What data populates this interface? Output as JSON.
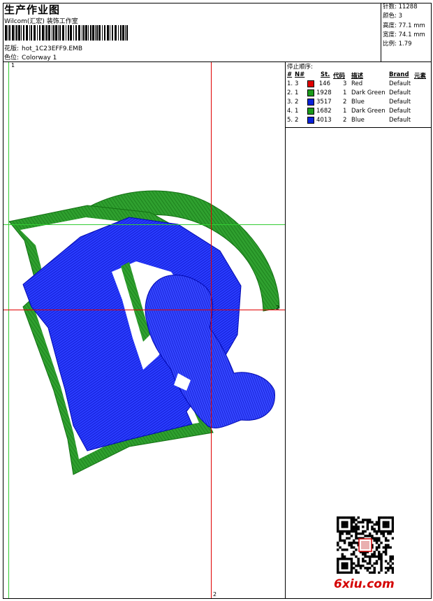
{
  "header": {
    "title": "生产作业图",
    "company": "Wilcom(汇宏) 装饰工作室",
    "design_label": "花版:",
    "design_file": "hot_1C23EFF9.EMB",
    "colorway_label": "色位:",
    "colorway": "Colorway 1"
  },
  "specs": [
    {
      "label": "针数:",
      "value": "11288"
    },
    {
      "label": "颜色:",
      "value": "3"
    },
    {
      "label": "高度:",
      "value": "77.1 mm"
    },
    {
      "label": "宽度:",
      "value": "74.1 mm"
    },
    {
      "label": "比例:",
      "value": "1.79"
    }
  ],
  "stop_sequence": {
    "title": "停止顺序:",
    "columns": [
      "#",
      "N#",
      "St.",
      "代码",
      "描述",
      "Brand",
      "元素"
    ],
    "rows": [
      {
        "idx": "1.",
        "n": "3",
        "color": "#e00000",
        "st": "146",
        "code": "3",
        "desc": "Red",
        "brand": "Default"
      },
      {
        "idx": "2.",
        "n": "1",
        "color": "#1a9a1a",
        "st": "1928",
        "code": "1",
        "desc": "Dark Green",
        "brand": "Default"
      },
      {
        "idx": "3.",
        "n": "2",
        "color": "#0a22d8",
        "st": "3517",
        "code": "2",
        "desc": "Blue",
        "brand": "Default"
      },
      {
        "idx": "4.",
        "n": "1",
        "color": "#1a9a1a",
        "st": "1682",
        "code": "1",
        "desc": "Dark Green",
        "brand": "Default"
      },
      {
        "idx": "5.",
        "n": "2",
        "color": "#0a22d8",
        "st": "4013",
        "code": "2",
        "desc": "Blue",
        "brand": "Default"
      }
    ]
  },
  "guides": {
    "top_left": "1",
    "right_mid": "2",
    "bottom": "2"
  },
  "watermark": {
    "num": "6",
    "text": "xiu.com"
  }
}
